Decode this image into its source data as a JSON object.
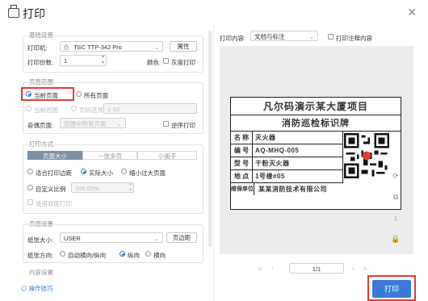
{
  "window": {
    "title": "打印",
    "close_icon": "close-icon"
  },
  "settings": {
    "basic": {
      "group_title": "基础设置",
      "printer_label": "打印机:",
      "printer_value": "TSC TTP-342 Pro",
      "properties_button": "属性",
      "copies_label": "打印份数:",
      "copies_value": "1",
      "color_label": "颜色:",
      "grayscale_label": "灰度打印"
    },
    "range": {
      "group_title": "页面范围",
      "current_page": "当前页面",
      "all_pages": "所有页面",
      "current_view": "当前视图",
      "page_select_label": "页码选择:",
      "page_select_placeholder": "1-10",
      "odd_even_label": "奇偶页面:",
      "odd_even_value": "范围中所有页面",
      "reverse_label": "逆序打印"
    },
    "mode": {
      "group_title": "打印方式",
      "tabs": [
        "页面大小",
        "一张多页",
        "小册子"
      ],
      "fit_printable": "适合打印边距",
      "actual_size": "实际大小",
      "shrink_large": "缩小过大页面",
      "custom_scale": "自定义比例",
      "custom_scale_value": "100.00%",
      "double_sided": "使用双面打印"
    },
    "page": {
      "group_title": "页面设置",
      "paper_size_label": "纸张大小:",
      "paper_size_value": "USER",
      "margins_button": "页边距",
      "orientation_label": "纸张方向:",
      "auto_orientation": "自动横向/纵向",
      "portrait": "纵向",
      "landscape": "横向"
    },
    "content": {
      "group_title": "内容设置"
    },
    "help_link": "操作技巧"
  },
  "preview": {
    "content_label": "打印内容:",
    "content_value": "文档与标注",
    "print_annotations": "打印注释内容",
    "label": {
      "title": "凡尔码演示某大厦项目",
      "subtitle": "消防巡检标识牌",
      "rows": [
        {
          "k": "名 称",
          "v": "灭火器"
        },
        {
          "k": "编 号",
          "v": "AQ-MHQ-005"
        },
        {
          "k": "型 号",
          "v": "干粉灭火器"
        },
        {
          "k": "地 点",
          "v": "1号楼#05"
        },
        {
          "k": "维保单位",
          "v": "某某消防技术有限公司"
        }
      ]
    },
    "pager": {
      "current": "1/1"
    }
  },
  "actions": {
    "print_button": "打印"
  },
  "colors": {
    "accent": "#3a7bd5",
    "highlight": "#e23a3a"
  }
}
